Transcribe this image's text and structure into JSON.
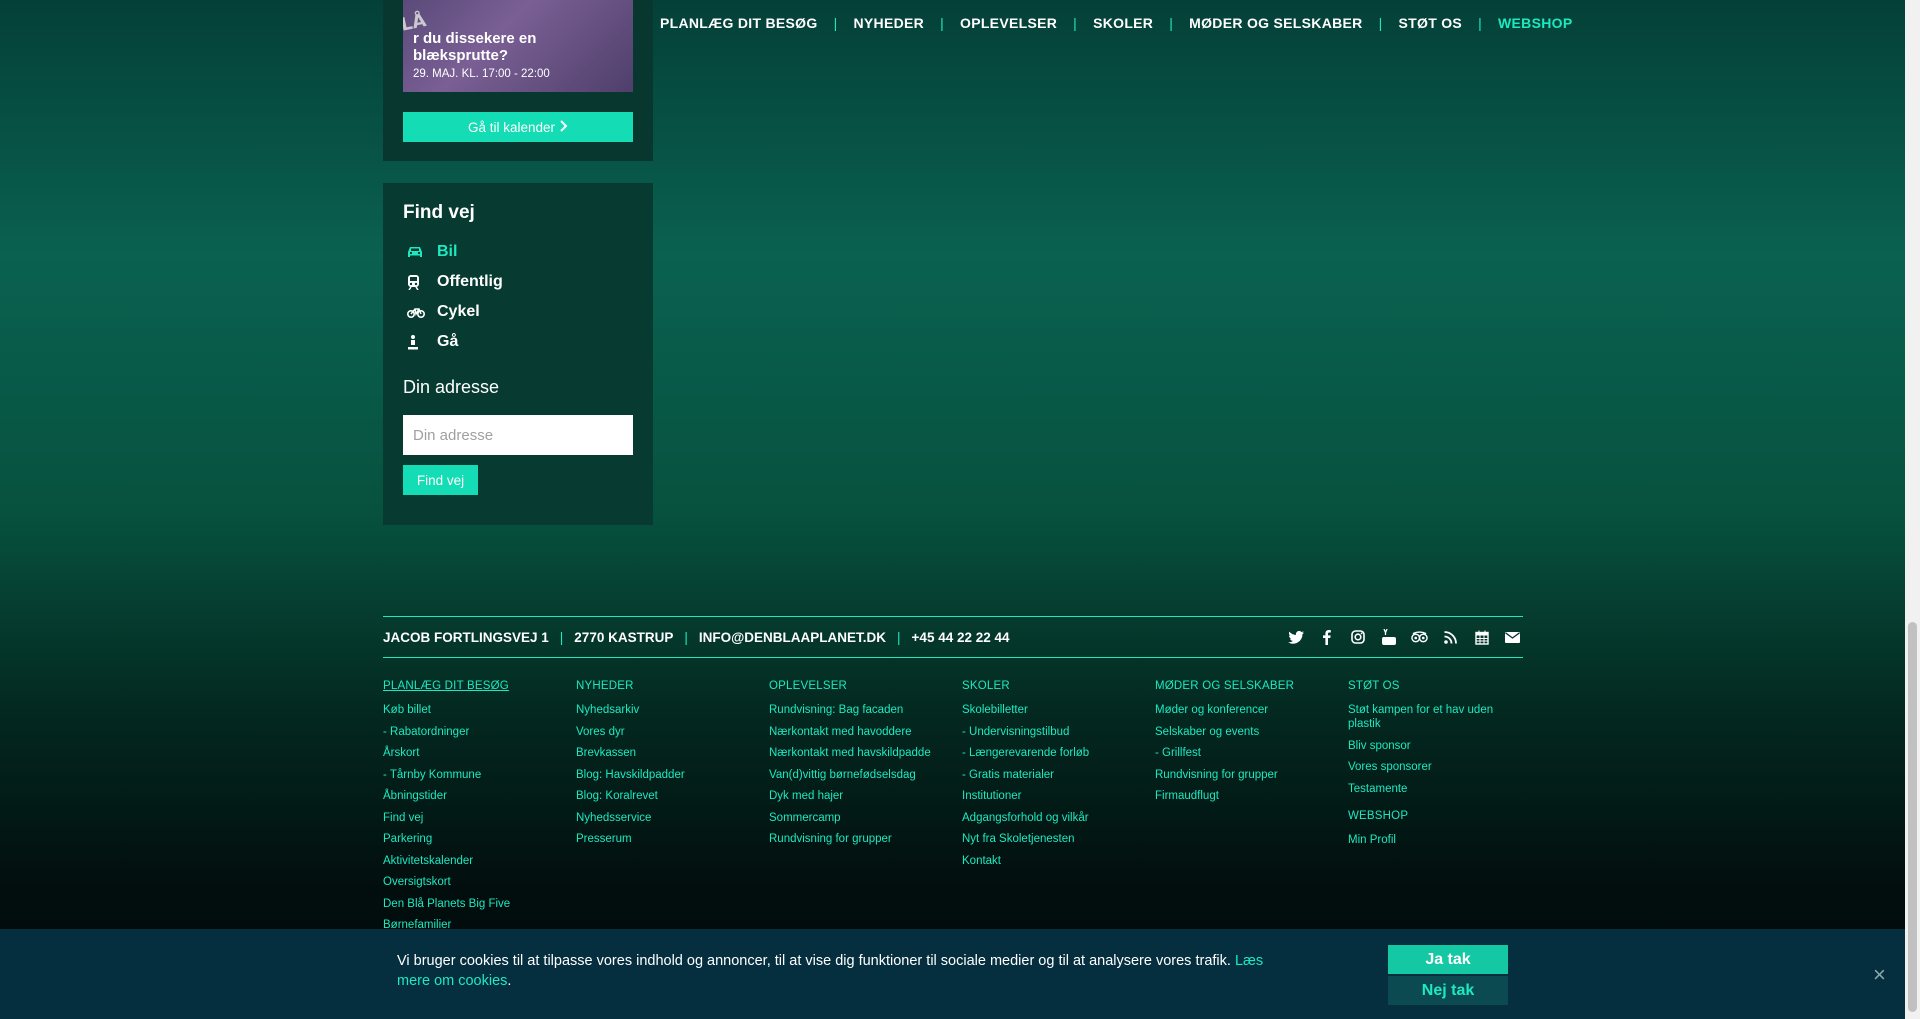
{
  "nav": {
    "items": [
      "PLANLÆG DIT BESØG",
      "NYHEDER",
      "OPLEVELSER",
      "SKOLER",
      "MØDER OG SELSKABER",
      "STØT OS"
    ],
    "webshop": "WEBSHOP",
    "separator": "|"
  },
  "event": {
    "logo_text": "BLÅ",
    "title": "r du dissekere en blæksprutte?",
    "date": "29. MAJ. KL. 17:00 - 22:00",
    "calendar_button": "Gå til kalender"
  },
  "find_vej": {
    "heading": "Find vej",
    "modes": [
      {
        "label": "Bil",
        "icon": "car-icon",
        "active": true
      },
      {
        "label": "Offentlig",
        "icon": "train-icon",
        "active": false
      },
      {
        "label": "Cykel",
        "icon": "bicycle-icon",
        "active": false
      },
      {
        "label": "Gå",
        "icon": "walk-icon",
        "active": false
      }
    ],
    "address_label": "Din adresse",
    "address_placeholder": "Din adresse",
    "address_value": "",
    "button": "Find vej"
  },
  "footer": {
    "contact": {
      "address": "JACOB FORTLINGSVEJ 1",
      "city": "2770 KASTRUP",
      "email": "INFO@DENBLAAPLANET.DK",
      "phone": "+45 44 22 22 44",
      "separator": "|"
    },
    "social_icons": [
      "twitter-icon",
      "facebook-icon",
      "instagram-icon",
      "youtube-icon",
      "tripadvisor-icon",
      "rss-icon",
      "calendar-icon",
      "mail-icon"
    ],
    "columns": [
      {
        "heading": "PLANLÆG DIT BESØG",
        "links": [
          "Køb billet",
          "- Rabatordninger",
          "Årskort",
          "- Tårnby Kommune",
          "Åbningstider",
          "Find vej",
          "Parkering",
          "Aktivitetskalender",
          "Oversigtskort",
          "Den Blå Planets Big Five",
          "Børnefamilier"
        ]
      },
      {
        "heading": "NYHEDER",
        "links": [
          "Nyhedsarkiv",
          "Vores dyr",
          "Brevkassen",
          "Blog: Havskildpadder",
          "Blog: Koralrevet",
          "Nyhedsservice",
          "Presserum"
        ]
      },
      {
        "heading": "OPLEVELSER",
        "links": [
          "Rundvisning: Bag facaden",
          "Nærkontakt med havoddere",
          "Nærkontakt med havskildpadde",
          "Van(d)vittig børnefødselsdag",
          "Dyk med hajer",
          "Sommercamp",
          "Rundvisning for grupper"
        ]
      },
      {
        "heading": "SKOLER",
        "links": [
          "Skolebilletter",
          "- Undervisningstilbud",
          "- Længerevarende forløb",
          "- Gratis materialer",
          "Institutioner",
          "Adgangsforhold og vilkår",
          "Nyt fra Skoletjenesten",
          "Kontakt"
        ]
      },
      {
        "heading": "MØDER OG SELSKABER",
        "links": [
          "Møder og konferencer",
          "Selskaber og events",
          "- Grillfest",
          "Rundvisning for grupper",
          "Firmaudflugt"
        ]
      },
      {
        "heading": "STØT OS",
        "links": [
          "Støt kampen for et hav uden plastik",
          "Bliv sponsor",
          "Vores sponsorer",
          "Testamente"
        ],
        "heading2": "WEBSHOP",
        "links2": [
          "Min Profil"
        ]
      }
    ]
  },
  "cookie": {
    "text": "Vi bruger cookies til at tilpasse vores indhold og annoncer, til at vise dig funktioner til sociale medier og til at analysere vores trafik.",
    "link": "Læs mere om cookies",
    "end": ".",
    "accept": "Ja tak",
    "decline": "Nej tak",
    "close": "×"
  }
}
